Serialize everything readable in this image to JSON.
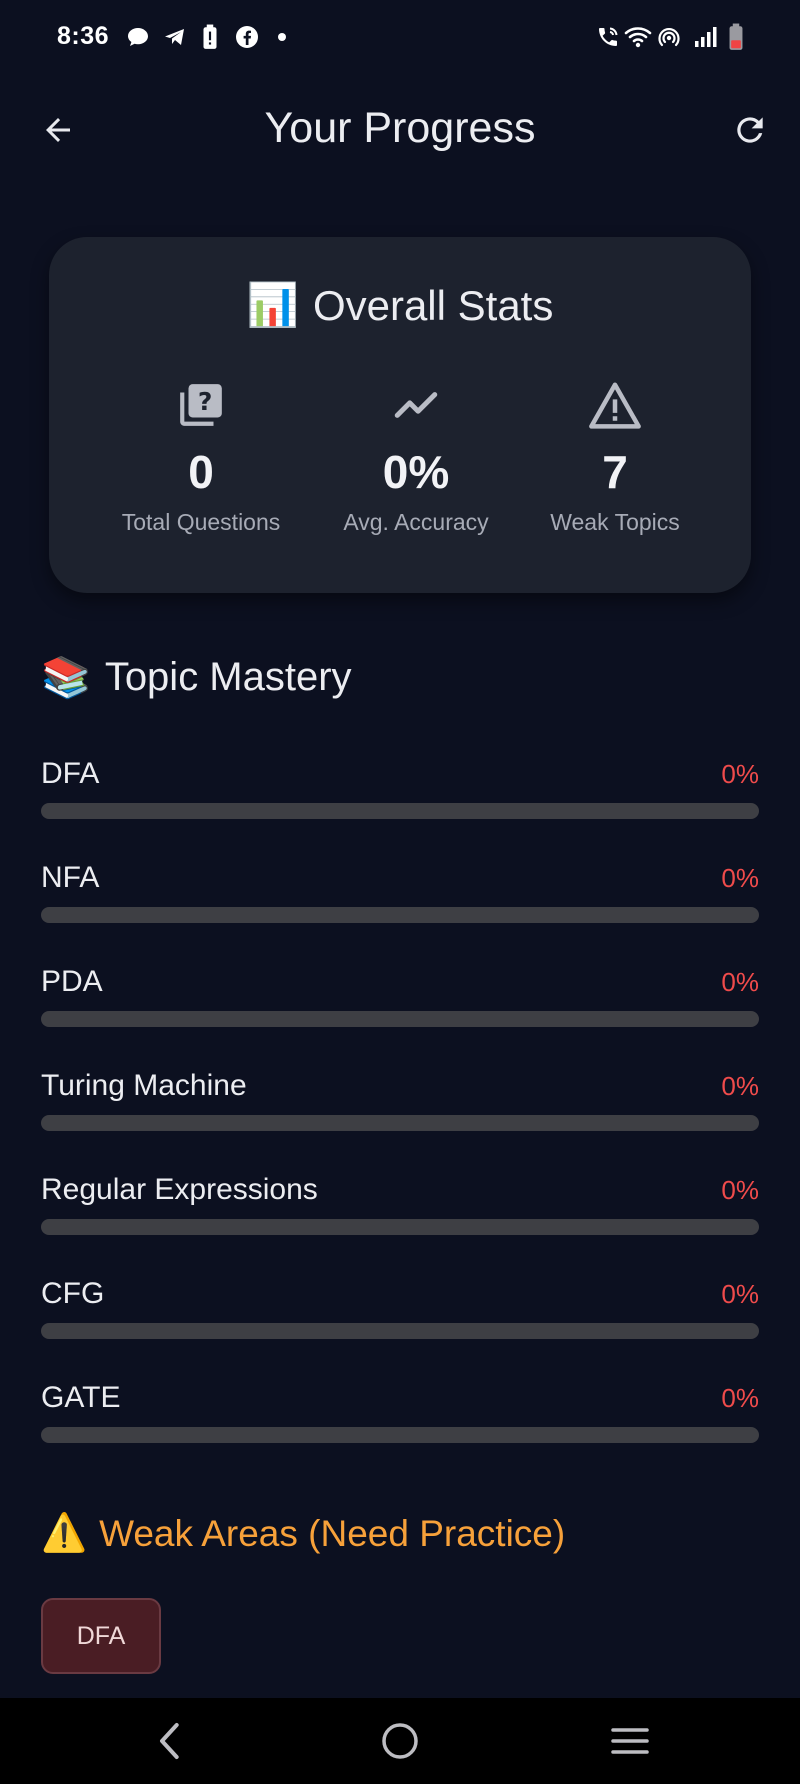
{
  "status_bar": {
    "time": "8:36",
    "icons": [
      "chat-bubble-icon",
      "telegram-icon",
      "battery-alert-icon",
      "facebook-icon",
      "dot-icon",
      "wifi-calling-icon",
      "wifi-icon",
      "hotspot-icon",
      "signal-icon",
      "battery-low-icon"
    ]
  },
  "app_bar": {
    "title": "Your Progress",
    "back_icon": "arrow-left-icon",
    "refresh_icon": "refresh-icon"
  },
  "overall_stats": {
    "emoji": "📊",
    "title": "Overall Stats",
    "items": [
      {
        "icon": "quiz-icon",
        "value": "0",
        "label": "Total Questions"
      },
      {
        "icon": "trending-up-icon",
        "value": "0%",
        "label": "Avg. Accuracy"
      },
      {
        "icon": "warning-icon",
        "value": "7",
        "label": "Weak Topics"
      }
    ]
  },
  "topic_mastery": {
    "emoji": "📚",
    "title": "Topic Mastery",
    "topics": [
      {
        "name": "DFA",
        "percent": "0%",
        "progress": 0
      },
      {
        "name": "NFA",
        "percent": "0%",
        "progress": 0
      },
      {
        "name": "PDA",
        "percent": "0%",
        "progress": 0
      },
      {
        "name": "Turing Machine",
        "percent": "0%",
        "progress": 0
      },
      {
        "name": "Regular Expressions",
        "percent": "0%",
        "progress": 0
      },
      {
        "name": "CFG",
        "percent": "0%",
        "progress": 0
      },
      {
        "name": "GATE",
        "percent": "0%",
        "progress": 0
      }
    ]
  },
  "weak_areas": {
    "emoji": "⚠️",
    "title": "Weak Areas (Need Practice)",
    "chips": [
      "DFA"
    ]
  },
  "colors": {
    "background": "#0c1020",
    "card": "#1d222e",
    "accent_red": "#ef4b4b",
    "accent_orange": "#f7a13a",
    "bar_track": "#3e3f44",
    "chip_bg": "#4a1d24"
  }
}
